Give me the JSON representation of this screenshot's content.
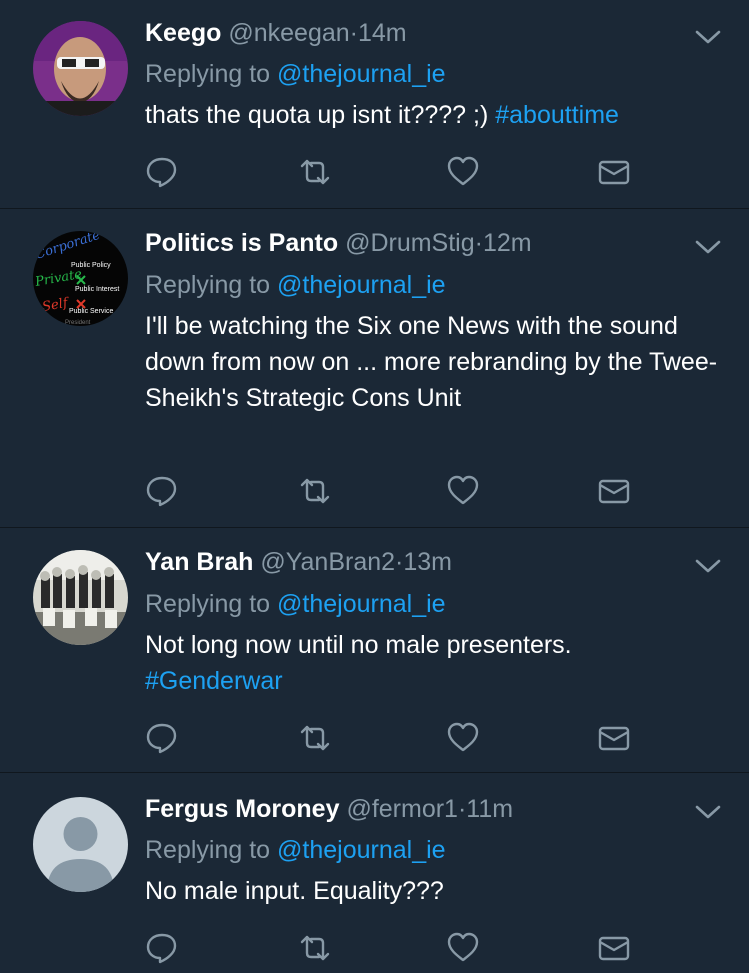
{
  "colors": {
    "background": "#1b2836",
    "divider": "#10171e",
    "link": "#1da1f2",
    "muted": "#8899a6",
    "text": "#ffffff"
  },
  "icons": {
    "more": "chevron-down-icon",
    "reply": "reply-icon",
    "retweet": "retweet-icon",
    "like": "heart-icon",
    "dm": "envelope-icon"
  },
  "tweets": [
    {
      "name": "Keego",
      "handle": "@nkeegan",
      "separator": "·",
      "time": "14m",
      "replying_prefix": "Replying to",
      "replying_to": "@thejournal_ie",
      "text": "thats the quota up isnt it???? ;) ",
      "hashtag": "#abouttime",
      "avatar": "avatar-keego"
    },
    {
      "name": "Politics is Panto",
      "handle": "@DrumStig",
      "separator": "·",
      "time": "12m",
      "replying_prefix": "Replying to",
      "replying_to": "@thejournal_ie",
      "text": "I'll be watching the Six one News with the sound down from now on ... more rebranding by the Twee-Sheikh's Strategic Cons Unit",
      "hashtag": "",
      "avatar": "avatar-politics",
      "avatar_text": {
        "corporate": "Corporate",
        "public_policy": "Public Policy",
        "private": "Private",
        "public_interest": "Public Interest",
        "self": "Self",
        "public_service": "Public Service",
        "bottom": "President"
      }
    },
    {
      "name": "Yan Brah",
      "handle": "@YanBran2",
      "separator": "·",
      "time": "13m",
      "replying_prefix": "Replying to",
      "replying_to": "@thejournal_ie",
      "text": "Not long now until no male presenters.",
      "hashtag": "#Genderwar",
      "avatar": "avatar-yanbrah"
    },
    {
      "name": "Fergus Moroney",
      "handle": "@fermor1",
      "separator": "·",
      "time": "11m",
      "replying_prefix": "Replying to",
      "replying_to": "@thejournal_ie",
      "text": "No male input. Equality???",
      "hashtag": "",
      "avatar": "avatar-default"
    }
  ]
}
